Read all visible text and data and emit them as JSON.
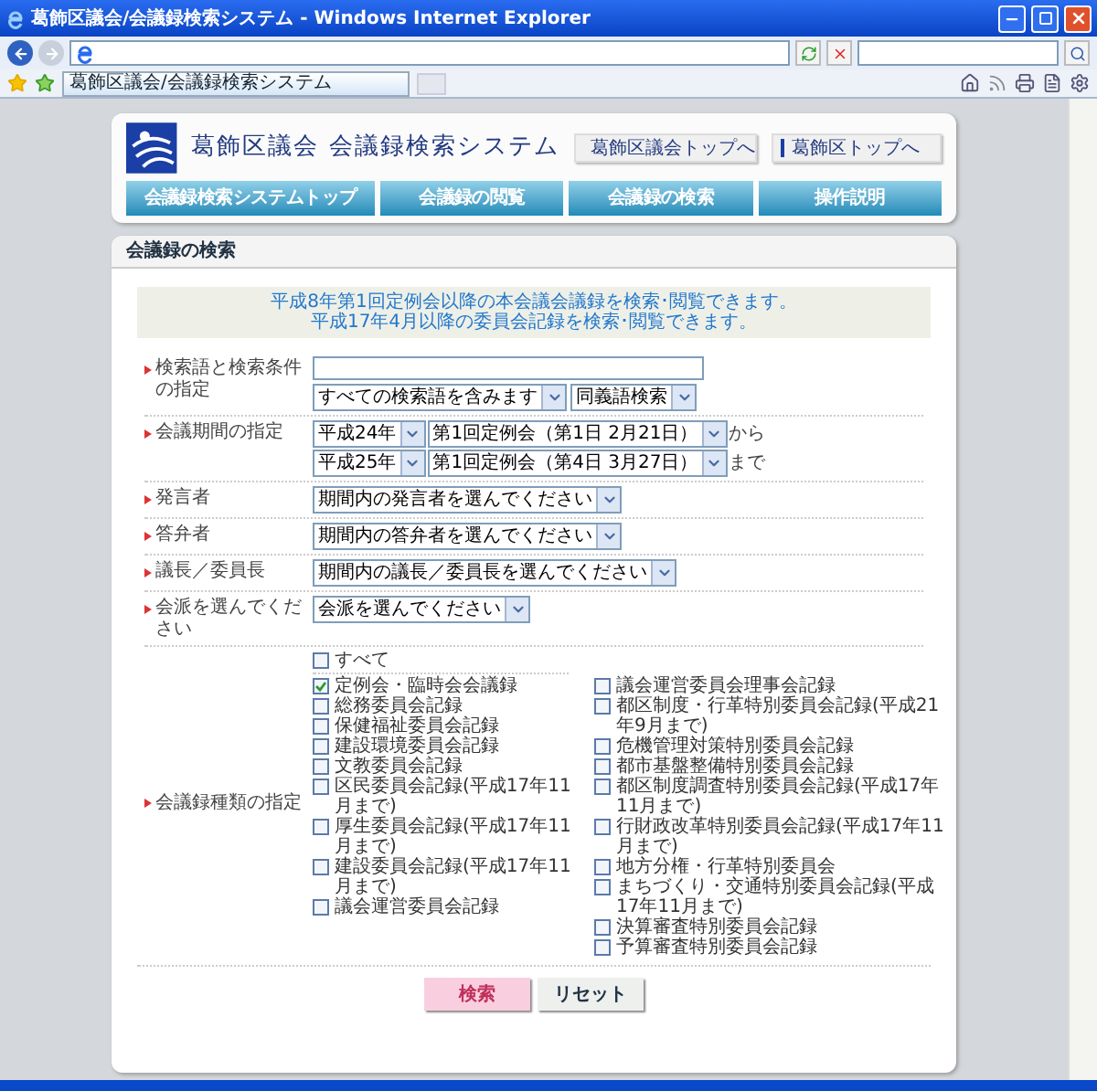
{
  "browser": {
    "title": "葛飾区議会/会議録検索システム - Windows Internet Explorer",
    "tab_title": "葛飾区議会/会議録検索システム"
  },
  "header": {
    "site_title": "葛飾区議会 会議録検索システム",
    "links": [
      "葛飾区議会トップへ",
      "葛飾区トップへ"
    ],
    "nav": [
      "会議録検索システムトップ",
      "会議録の閲覧",
      "会議録の検索",
      "操作説明"
    ]
  },
  "panel": {
    "title": "会議録の検索",
    "notice": [
      "平成8年第1回定例会以降の本会議会議録を検索･閲覧できます。",
      "平成17年4月以降の委員会記録を検索･閲覧できます。"
    ]
  },
  "form": [
    {
      "kind": "keyword",
      "label": "検索語と検索条件の指定",
      "selects": [
        "すべての検索語を含みます",
        "同義語検索"
      ]
    },
    {
      "kind": "period",
      "label": "会議期間の指定",
      "rows": [
        {
          "year": "平成24年",
          "session": "第1回定例会（第1日 2月21日）",
          "suffix": "から"
        },
        {
          "year": "平成25年",
          "session": "第1回定例会（第4日 3月27日）",
          "suffix": "まで"
        }
      ]
    },
    {
      "kind": "select",
      "label": "発言者",
      "value": "期間内の発言者を選んでください"
    },
    {
      "kind": "select",
      "label": "答弁者",
      "value": "期間内の答弁者を選んでください"
    },
    {
      "kind": "select",
      "label": "議長／委員長",
      "value": "期間内の議長／委員長を選んでください"
    },
    {
      "kind": "select",
      "label": "会派を選んでください",
      "value": "会派を選んでください"
    },
    {
      "kind": "checkboxes",
      "label": "会議録種類の指定",
      "all": {
        "label": "すべて",
        "checked": false
      },
      "columns": [
        [
          {
            "label": "定例会・臨時会会議録",
            "checked": true
          },
          {
            "label": "総務委員会記録",
            "checked": false
          },
          {
            "label": "保健福祉委員会記録",
            "checked": false
          },
          {
            "label": "建設環境委員会記録",
            "checked": false
          },
          {
            "label": "文教委員会記録",
            "checked": false
          },
          {
            "label": "区民委員会記録(平成17年11月まで)",
            "checked": false
          },
          {
            "label": "厚生委員会記録(平成17年11月まで)",
            "checked": false
          },
          {
            "label": "建設委員会記録(平成17年11月まで)",
            "checked": false
          },
          {
            "label": "議会運営委員会記録",
            "checked": false
          }
        ],
        [
          {
            "label": "議会運営委員会理事会記録",
            "checked": false
          },
          {
            "label": "都区制度・行革特別委員会記録(平成21年9月まで)",
            "checked": false
          },
          {
            "label": "危機管理対策特別委員会記録",
            "checked": false
          },
          {
            "label": "都市基盤整備特別委員会記録",
            "checked": false
          },
          {
            "label": "都区制度調査特別委員会記録(平成17年11月まで)",
            "checked": false
          },
          {
            "label": "行財政改革特別委員会記録(平成17年11月まで)",
            "checked": false
          },
          {
            "label": "地方分権・行革特別委員会",
            "checked": false
          },
          {
            "label": "まちづくり・交通特別委員会記録(平成17年11月まで)",
            "checked": false
          },
          {
            "label": "決算審査特別委員会記録",
            "checked": false
          },
          {
            "label": "予算審査特別委員会記録",
            "checked": false
          }
        ]
      ]
    }
  ],
  "buttons": [
    {
      "label": "検索",
      "kind": "primary"
    },
    {
      "label": "リセット",
      "kind": "secondary"
    }
  ]
}
